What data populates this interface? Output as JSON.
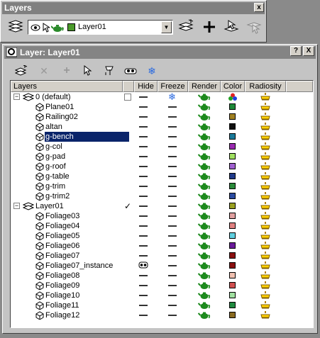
{
  "outer": {
    "title": "Layers",
    "close": "x",
    "current_layer": "Layer01",
    "current_layer_color": "#4a9a2a"
  },
  "dialog": {
    "title": "Layer: Layer01",
    "help": "?",
    "close": "X"
  },
  "columns": {
    "layers": "Layers",
    "hide": "Hide",
    "freeze": "Freeze",
    "render": "Render",
    "color": "Color",
    "radiosity": "Radiosity"
  },
  "rows": [
    {
      "name": "0 (default)",
      "type": "layer",
      "expanded": true,
      "hidden": false,
      "color": "multi",
      "active": false
    },
    {
      "name": "Plane01",
      "type": "object",
      "hidden": false,
      "color": "#1e8a3a"
    },
    {
      "name": "Railing02",
      "type": "object",
      "hidden": false,
      "color": "#a08020"
    },
    {
      "name": "altan",
      "type": "object",
      "hidden": false,
      "color": "#101010"
    },
    {
      "name": "g-bench",
      "type": "object",
      "hidden": false,
      "color": "#1a7a9a",
      "selected": true
    },
    {
      "name": "g-col",
      "type": "object",
      "hidden": false,
      "color": "#9a2ab0"
    },
    {
      "name": "g-pad",
      "type": "object",
      "hidden": false,
      "color": "#a0e060"
    },
    {
      "name": "g-roof",
      "type": "object",
      "hidden": false,
      "color": "#a060d0"
    },
    {
      "name": "g-table",
      "type": "object",
      "hidden": false,
      "color": "#203a8a"
    },
    {
      "name": "g-trim",
      "type": "object",
      "hidden": false,
      "color": "#2a8a3a"
    },
    {
      "name": "g-trim2",
      "type": "object",
      "hidden": false,
      "color": "#2a4aa0"
    },
    {
      "name": "Layer01",
      "type": "layer",
      "expanded": true,
      "hidden": false,
      "color": "#9aa020",
      "active": true
    },
    {
      "name": "Foliage03",
      "type": "object",
      "hidden": false,
      "color": "#e0a0a0"
    },
    {
      "name": "Foliage04",
      "type": "object",
      "hidden": false,
      "color": "#e08080"
    },
    {
      "name": "Foliage05",
      "type": "object",
      "hidden": false,
      "color": "#60d0e0"
    },
    {
      "name": "Foliage06",
      "type": "object",
      "hidden": false,
      "color": "#6a1a9a"
    },
    {
      "name": "Foliage07",
      "type": "object",
      "hidden": false,
      "color": "#8a1010"
    },
    {
      "name": "Foliage07_instance",
      "type": "object",
      "hidden": true,
      "color": "#8a1010"
    },
    {
      "name": "Foliage08",
      "type": "object",
      "hidden": false,
      "color": "#f0c0b0"
    },
    {
      "name": "Foliage09",
      "type": "object",
      "hidden": false,
      "color": "#d05050"
    },
    {
      "name": "Foliage10",
      "type": "object",
      "hidden": false,
      "color": "#a0e0a0"
    },
    {
      "name": "Foliage11",
      "type": "object",
      "hidden": false,
      "color": "#208a40"
    },
    {
      "name": "Foliage12",
      "type": "object",
      "hidden": false,
      "color": "#8a6a20"
    }
  ]
}
